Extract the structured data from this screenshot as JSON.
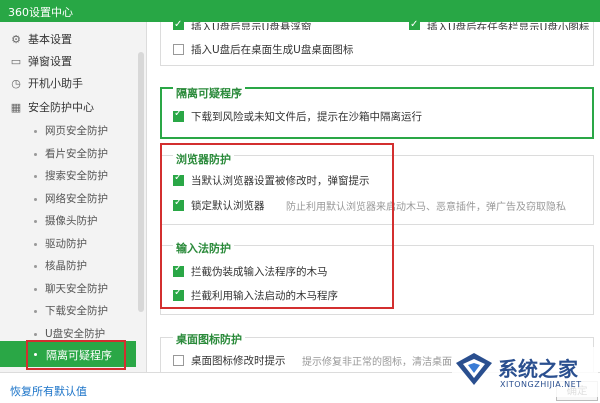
{
  "window": {
    "title": "360设置中心"
  },
  "sidebar": {
    "top_items": [
      {
        "label": "基本设置",
        "icon": "gear-icon"
      },
      {
        "label": "弹窗设置",
        "icon": "window-icon"
      },
      {
        "label": "开机小助手",
        "icon": "clock-icon"
      },
      {
        "label": "安全防护中心",
        "icon": "grid-icon"
      }
    ],
    "sub_items": [
      "网页安全防护",
      "看片安全防护",
      "搜索安全防护",
      "网络安全防护",
      "摄像头防护",
      "驱动防护",
      "核晶防护",
      "聊天安全防护",
      "下载安全防护",
      "U盘安全防护"
    ],
    "active_item": "隔离可疑程序"
  },
  "content": {
    "top": {
      "item1": "插入U盘后显示U盘悬浮窗",
      "item2": "插入U盘后在任务栏显示U盘小图标",
      "item3": "插入U盘后在桌面生成U盘桌面图标"
    },
    "isolate": {
      "title": "隔离可疑程序",
      "option": "下载到风险或未知文件后，提示在沙箱中隔离运行"
    },
    "browser": {
      "title": "浏览器防护",
      "opt1": "当默认浏览器设置被修改时，弹窗提示",
      "opt2": "锁定默认浏览器",
      "opt2_hint": "防止利用默认浏览器来启动木马、恶意插件，弹广告及窃取隐私"
    },
    "ime": {
      "title": "输入法防护",
      "opt1": "拦截伪装成输入法程序的木马",
      "opt2": "拦截利用输入法启动的木马程序"
    },
    "desktop": {
      "title": "桌面图标防护",
      "opt1": "桌面图标修改时提示",
      "opt1_hint": "提示修复非正常的图标，清洁桌面"
    }
  },
  "footer": {
    "restore": "恢复所有默认值",
    "ok": "确定"
  },
  "watermark": {
    "name": "系统之家",
    "url": "XITONGZHIJIA.NET"
  },
  "colors": {
    "accent": "#2aa746",
    "highlight_box": "#d32f2f",
    "section_title": "#2a8a3a"
  }
}
